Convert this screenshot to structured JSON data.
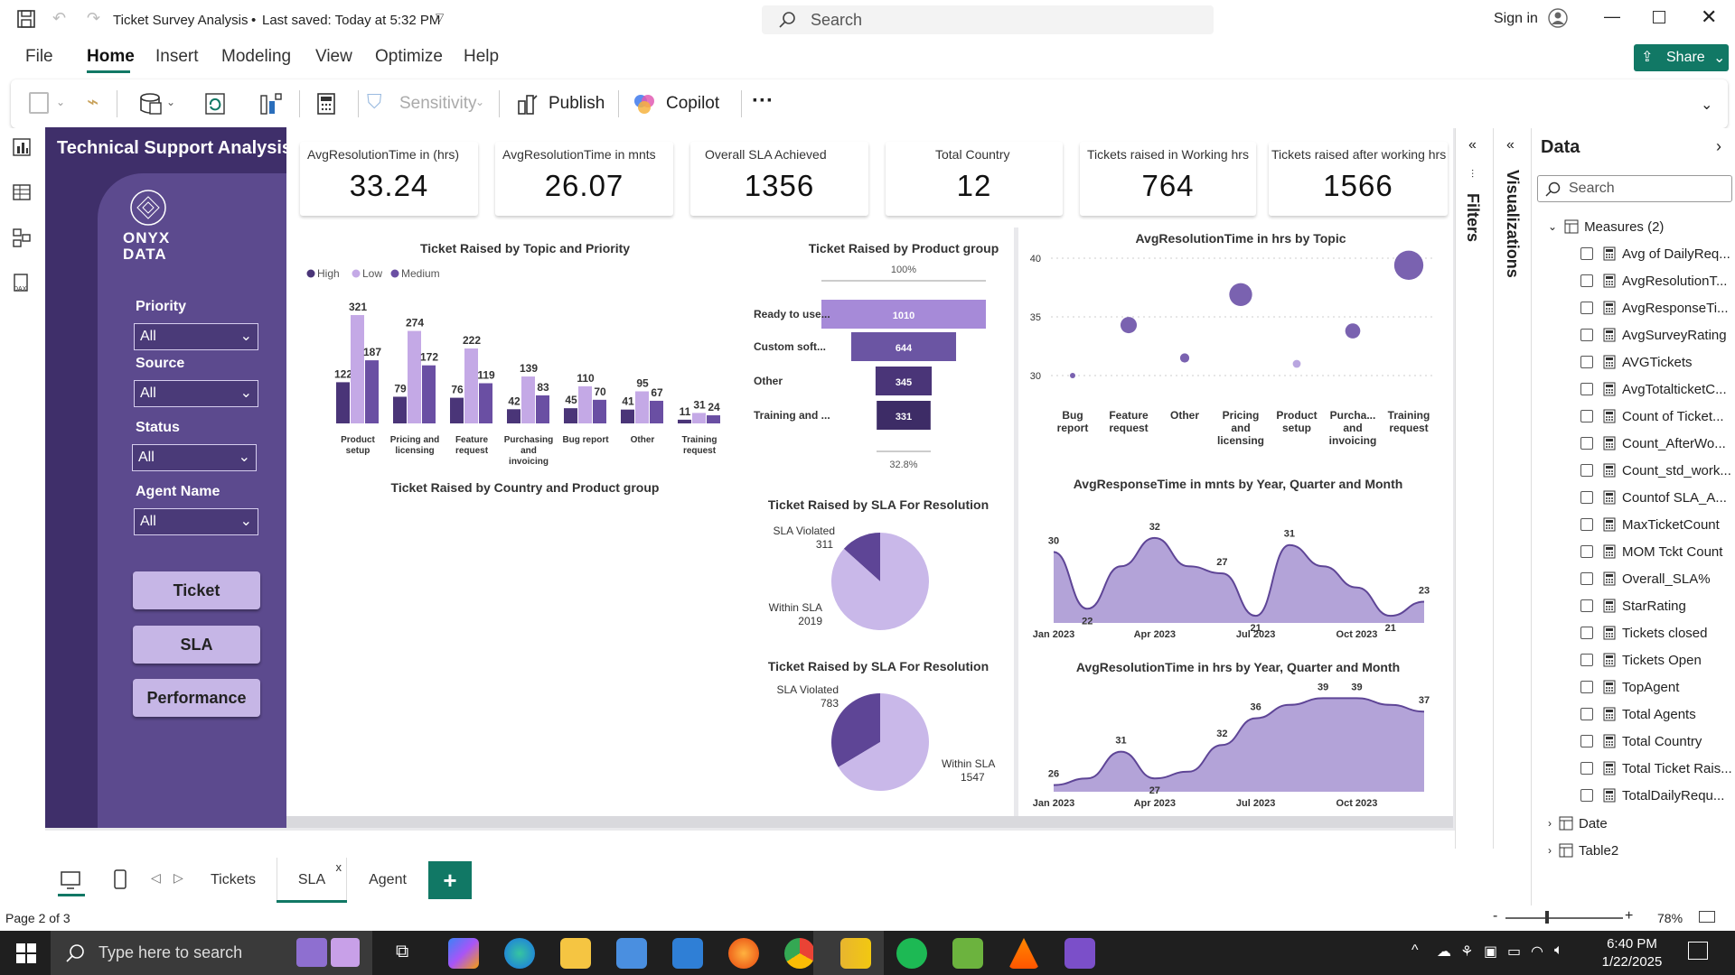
{
  "titlebar": {
    "doc_title": "Ticket Survey Analysis",
    "saved": "Last saved: Today at 5:32 PM",
    "search_placeholder": "Search",
    "sign_in": "Sign in"
  },
  "menu": {
    "items": [
      "File",
      "Home",
      "Insert",
      "Modeling",
      "View",
      "Optimize",
      "Help"
    ],
    "active": "Home",
    "share": "Share"
  },
  "ribbon": {
    "sensitivity": "Sensitivity",
    "publish": "Publish",
    "copilot": "Copilot",
    "more": "···"
  },
  "report": {
    "title": "Technical Support Analysis",
    "logo_line1": "ONYX",
    "logo_line2": "DATA",
    "kpis": [
      {
        "label": "AvgResolutionTime in (hrs)",
        "value": "33.24"
      },
      {
        "label": "AvgResolutionTime in mnts",
        "value": "26.07"
      },
      {
        "label": "Overall SLA Achieved",
        "value": "1356"
      },
      {
        "label": "Total Country",
        "value": "12"
      },
      {
        "label": "Tickets raised in Working hrs",
        "value": "764"
      },
      {
        "label": "Tickets raised after working hrs",
        "value": "1566"
      }
    ],
    "slicers": [
      {
        "label": "Priority",
        "value": "All"
      },
      {
        "label": "Source",
        "value": "All"
      },
      {
        "label": "Status",
        "value": "All"
      },
      {
        "label": "Agent Name",
        "value": "All"
      }
    ],
    "nav_buttons": [
      "Ticket",
      "SLA",
      "Performance"
    ],
    "country_chart_title": "Ticket Raised by Country and Product group"
  },
  "chart_data": [
    {
      "type": "bar",
      "title": "Ticket Raised by Topic and Priority",
      "categories": [
        "Product setup",
        "Pricing and licensing",
        "Feature request",
        "Purchasing and invoicing",
        "Bug report",
        "Other",
        "Training request"
      ],
      "series": [
        {
          "name": "High",
          "values": [
            122,
            79,
            76,
            42,
            45,
            41,
            11
          ],
          "color": "#4a3578"
        },
        {
          "name": "Low",
          "values": [
            321,
            274,
            222,
            139,
            110,
            95,
            31
          ],
          "color": "#c4a9e6"
        },
        {
          "name": "Medium",
          "values": [
            187,
            172,
            119,
            83,
            70,
            67,
            24
          ],
          "color": "#6a4fa3"
        }
      ]
    },
    {
      "type": "bar",
      "title": "Ticket Raised by Product group",
      "subtype": "funnel",
      "categories": [
        "Ready to use...",
        "Custom soft...",
        "Other",
        "Training and ..."
      ],
      "values": [
        1010,
        644,
        345,
        331
      ],
      "top_label": "100%",
      "bottom_label": "32.8%"
    },
    {
      "type": "scatter",
      "title": "AvgResolutionTime in hrs by Topic",
      "categories": [
        "Bug report",
        "Feature request",
        "Other",
        "Pricing and licensing",
        "Product setup",
        "Purcha... and invoicing",
        "Training request"
      ],
      "values": [
        30.0,
        34.3,
        31.5,
        36.9,
        31.0,
        33.8,
        39.4
      ],
      "ylim": [
        30,
        40
      ],
      "yticks": [
        30,
        35,
        40
      ]
    },
    {
      "type": "pie",
      "title": "Ticket Raised by SLA For Resolution",
      "slices": [
        {
          "label": "SLA Violated",
          "value": 311
        },
        {
          "label": "Within SLA",
          "value": 2019
        }
      ]
    },
    {
      "type": "pie",
      "title": "Ticket Raised by SLA For Resolution",
      "slices": [
        {
          "label": "SLA Violated",
          "value": 783
        },
        {
          "label": "Within SLA",
          "value": 1547
        }
      ]
    },
    {
      "type": "area",
      "title": "AvgResponseTime in mnts by Year, Quarter and Month",
      "x_ticks": [
        "Jan 2023",
        "Apr 2023",
        "Jul 2023",
        "Oct 2023"
      ],
      "values": [
        30,
        22,
        28,
        32,
        28,
        27,
        21,
        31,
        28,
        25,
        21,
        23
      ],
      "labels": [
        {
          "i": 0,
          "v": "30"
        },
        {
          "i": 1,
          "v": "22"
        },
        {
          "i": 3,
          "v": "32"
        },
        {
          "i": 5,
          "v": "27"
        },
        {
          "i": 6,
          "v": "21"
        },
        {
          "i": 7,
          "v": "31"
        },
        {
          "i": 10,
          "v": "21"
        },
        {
          "i": 11,
          "v": "23"
        }
      ]
    },
    {
      "type": "area",
      "title": "AvgResolutionTime in hrs by Year, Quarter and Month",
      "x_ticks": [
        "Jan 2023",
        "Apr 2023",
        "Jul 2023",
        "Oct 2023"
      ],
      "values": [
        26,
        27,
        31,
        27,
        28,
        32,
        36,
        38,
        39,
        39,
        38,
        37
      ],
      "labels": [
        {
          "i": 0,
          "v": "26"
        },
        {
          "i": 2,
          "v": "31"
        },
        {
          "i": 3,
          "v": "27"
        },
        {
          "i": 5,
          "v": "32"
        },
        {
          "i": 6,
          "v": "36"
        },
        {
          "i": 8,
          "v": "39"
        },
        {
          "i": 9,
          "v": "39"
        },
        {
          "i": 11,
          "v": "37"
        }
      ]
    }
  ],
  "panes": {
    "filters": "Filters",
    "visualizations": "Visualizations",
    "data_title": "Data",
    "search_placeholder": "Search",
    "measures_group": "Measures (2)",
    "fields": [
      "Avg of DailyReq...",
      "AvgResolutionT...",
      "AvgResponseTi...",
      "AvgSurveyRating",
      "AVGTickets",
      "AvgTotalticketC...",
      "Count of Ticket...",
      "Count_AfterWo...",
      "Count_std_work...",
      "Countof SLA_A...",
      "MaxTicketCount",
      "MOM Tckt Count",
      "Overall_SLA%",
      "StarRating",
      "Tickets closed",
      "Tickets Open",
      "TopAgent",
      "Total Agents",
      "Total Country",
      "Total Ticket Rais...",
      "TotalDailyRequ..."
    ],
    "tables": [
      "Date",
      "Table2"
    ]
  },
  "tabs": {
    "items": [
      "Tickets",
      "SLA",
      "Agent"
    ],
    "active": "SLA",
    "add": "+"
  },
  "status": {
    "page": "Page 2 of 3",
    "zoom": "78%"
  },
  "taskbar": {
    "search_placeholder": "Type here to search",
    "time": "6:40 PM",
    "date": "1/22/2025"
  },
  "colors": {
    "purple_dark": "#3f2f6a",
    "purple_mid": "#6a4fa3",
    "purple_light": "#c4a9e6",
    "pbi_green": "#117865"
  }
}
